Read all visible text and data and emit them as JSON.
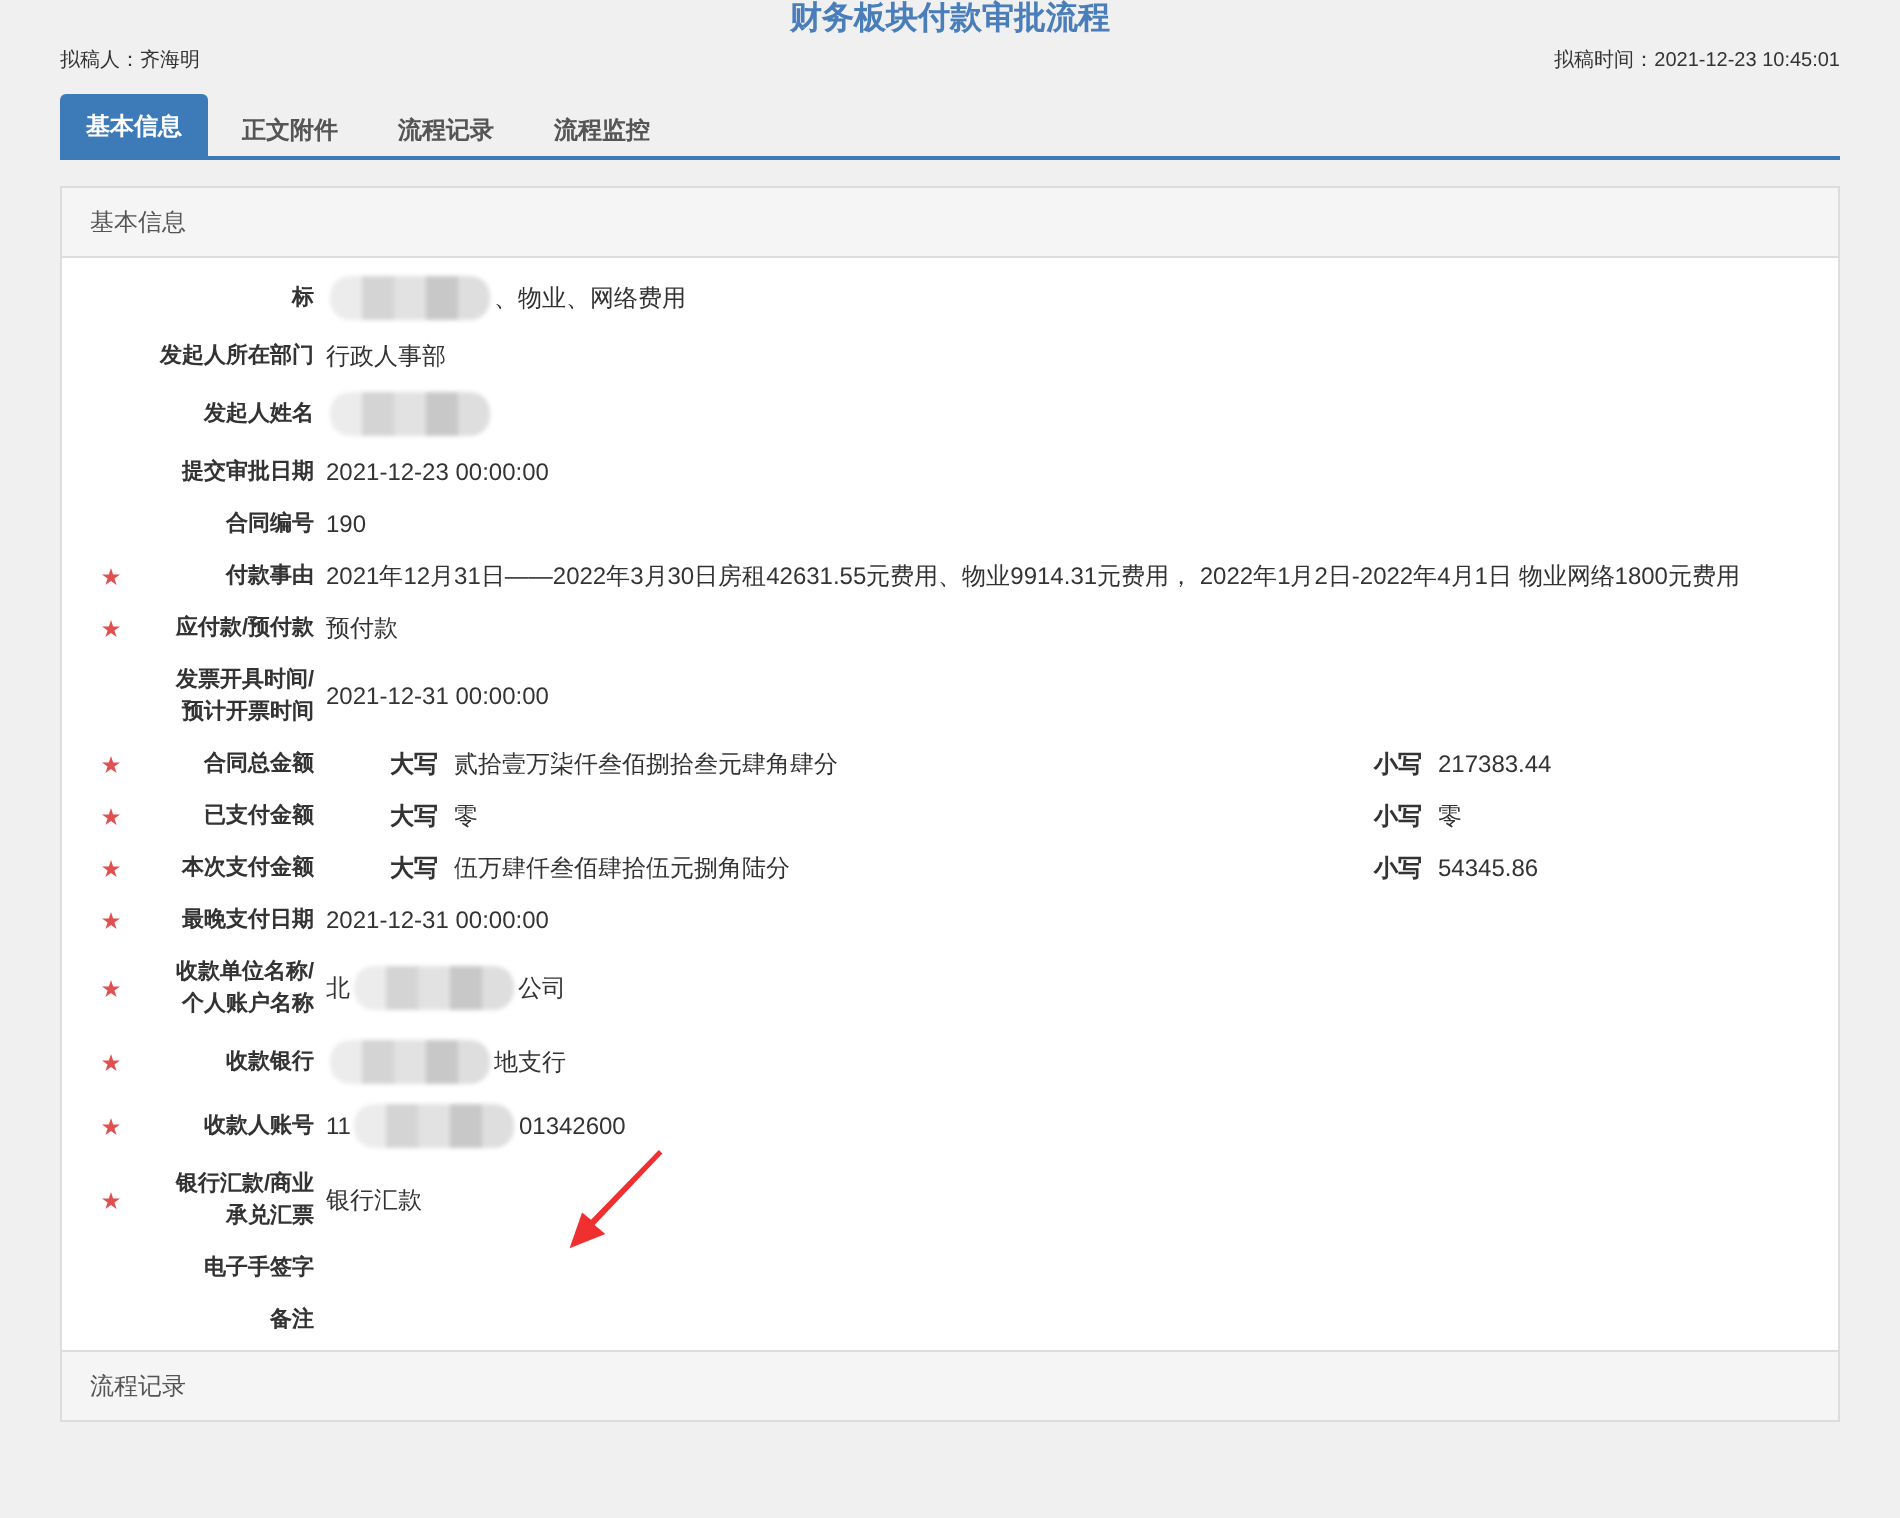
{
  "title": "财务板块付款审批流程",
  "drafter": {
    "label": "拟稿人：",
    "value": "齐海明"
  },
  "draft_time": {
    "label": "拟稿时间：",
    "value": "2021-12-23 10:45:01"
  },
  "tabs": [
    {
      "label": "基本信息",
      "selected": true
    },
    {
      "label": "正文附件",
      "selected": false
    },
    {
      "label": "流程记录",
      "selected": false
    },
    {
      "label": "流程监控",
      "selected": false
    }
  ],
  "section": {
    "title": "基本信息"
  },
  "fields": [
    {
      "kind": "text",
      "label": "标",
      "required": false,
      "value": [
        {
          "kind": "redacted"
        },
        {
          "kind": "text",
          "text": "、物业、网络费用"
        }
      ]
    },
    {
      "kind": "text",
      "label": "发起人所在部门",
      "required": false,
      "value": [
        {
          "kind": "text",
          "text": "行政人事部"
        }
      ]
    },
    {
      "kind": "text",
      "label": "发起人姓名",
      "required": false,
      "value": [
        {
          "kind": "redacted"
        }
      ]
    },
    {
      "kind": "text",
      "label": "提交审批日期",
      "required": false,
      "value": [
        {
          "kind": "text",
          "text": "2021-12-23 00:00:00"
        }
      ]
    },
    {
      "kind": "text",
      "label": "合同编号",
      "required": false,
      "value": [
        {
          "kind": "text",
          "text": "190"
        }
      ]
    },
    {
      "kind": "text",
      "label": "付款事由",
      "required": true,
      "value": [
        {
          "kind": "text",
          "text": "2021年12月31日——2022年3月30日房租42631.55元费用、物业9914.31元费用， 2022年1月2日-2022年4月1日 物业网络1800元费用"
        }
      ]
    },
    {
      "kind": "text",
      "label": "应付款/预付款",
      "required": true,
      "value": [
        {
          "kind": "text",
          "text": "预付款"
        }
      ]
    },
    {
      "kind": "text",
      "label": "发票开具时间/预计开票时间",
      "required": false,
      "value": [
        {
          "kind": "text",
          "text": "2021-12-31 00:00:00"
        }
      ]
    },
    {
      "kind": "amount",
      "label": "合同总金额",
      "required": true,
      "upper_label": "大写",
      "upper": "贰拾壹万柒仟叁佰捌拾叁元肆角肆分",
      "lower_label": "小写",
      "lower": "217383.44"
    },
    {
      "kind": "amount",
      "label": "已支付金额",
      "required": true,
      "upper_label": "大写",
      "upper": "零",
      "lower_label": "小写",
      "lower": "零"
    },
    {
      "kind": "amount",
      "label": "本次支付金额",
      "required": true,
      "upper_label": "大写",
      "upper": "伍万肆仟叁佰肆拾伍元捌角陆分",
      "lower_label": "小写",
      "lower": "54345.86"
    },
    {
      "kind": "text",
      "label": "最晚支付日期",
      "required": true,
      "value": [
        {
          "kind": "text",
          "text": "2021-12-31 00:00:00"
        }
      ]
    },
    {
      "kind": "text",
      "label": "收款单位名称/个人账户名称",
      "required": true,
      "value": [
        {
          "kind": "text",
          "text": "北"
        },
        {
          "kind": "redacted"
        },
        {
          "kind": "text",
          "text": "公司"
        }
      ]
    },
    {
      "kind": "text",
      "label": "收款银行",
      "required": true,
      "value": [
        {
          "kind": "redacted"
        },
        {
          "kind": "text",
          "text": "地支行"
        }
      ]
    },
    {
      "kind": "text",
      "label": "收款人账号",
      "required": true,
      "value": [
        {
          "kind": "text",
          "text": "11"
        },
        {
          "kind": "redacted"
        },
        {
          "kind": "text",
          "text": "01342600"
        }
      ]
    },
    {
      "kind": "text",
      "label": "银行汇款/商业承兑汇票",
      "required": true,
      "value": [
        {
          "kind": "text",
          "text": "银行汇款"
        }
      ]
    },
    {
      "kind": "text",
      "label": "电子手签字",
      "required": false
    },
    {
      "kind": "text",
      "label": "备注",
      "required": false
    }
  ],
  "next_section": {
    "title": "流程记录"
  }
}
